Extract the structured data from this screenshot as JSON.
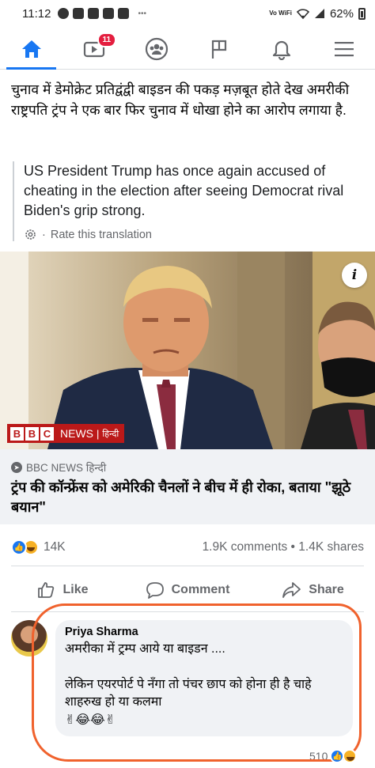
{
  "status_bar": {
    "time": "11:12",
    "network_label": "Vo WiFi",
    "battery": "62%"
  },
  "nav": {
    "tabs": [
      {
        "name": "home",
        "active": true
      },
      {
        "name": "watch",
        "badge": "11"
      },
      {
        "name": "groups"
      },
      {
        "name": "pages"
      },
      {
        "name": "notifications"
      },
      {
        "name": "menu"
      }
    ],
    "watch_badge": "11"
  },
  "post": {
    "text_hindi": "चुनाव में डेमोक्रेट प्रतिद्वंद्वी बाइडन की पकड़ मज़बूत होते देख अमरीकी राष्ट्रपति ट्रंप ने एक बार फिर चुनाव में धोखा होने का आरोप लगाया है.",
    "translation": "US President Trump has once again accused of cheating in the election after seeing Democrat rival Biden's grip strong.",
    "rate_translation": "Rate this translation",
    "rate_separator": "·"
  },
  "link": {
    "bbc_letters": [
      "B",
      "B",
      "C"
    ],
    "bbc_news": "NEWS",
    "bbc_separator": "|",
    "bbc_hindi": "हिन्दी",
    "source": "BBC NEWS हिन्दी",
    "title": "ट्रंप की कॉन्फ्रेंस को अमेरिकी चैनलों ने बीच में ही रोका, बताया \"झूठे बयान\""
  },
  "stats": {
    "reactions": "14K",
    "comments_shares": "1.9K comments • 1.4K shares"
  },
  "actions": {
    "like": "Like",
    "comment": "Comment",
    "share": "Share"
  },
  "comment": {
    "author": "Priya Sharma",
    "line1": "अमरीका में ट्रम्प आये या बाइडन ....",
    "line2": "लेकिन एयरपोर्ट पे नँगा तो पंचर छाप को होना ही है चाहे शाहरुख हो या कलमा",
    "emojis": "✌😂😂✌",
    "reaction_count": "510"
  },
  "colors": {
    "accent": "#1877f2",
    "badge": "#e41e3f",
    "bbc_red": "#bb1919",
    "highlight": "#f0622d"
  }
}
